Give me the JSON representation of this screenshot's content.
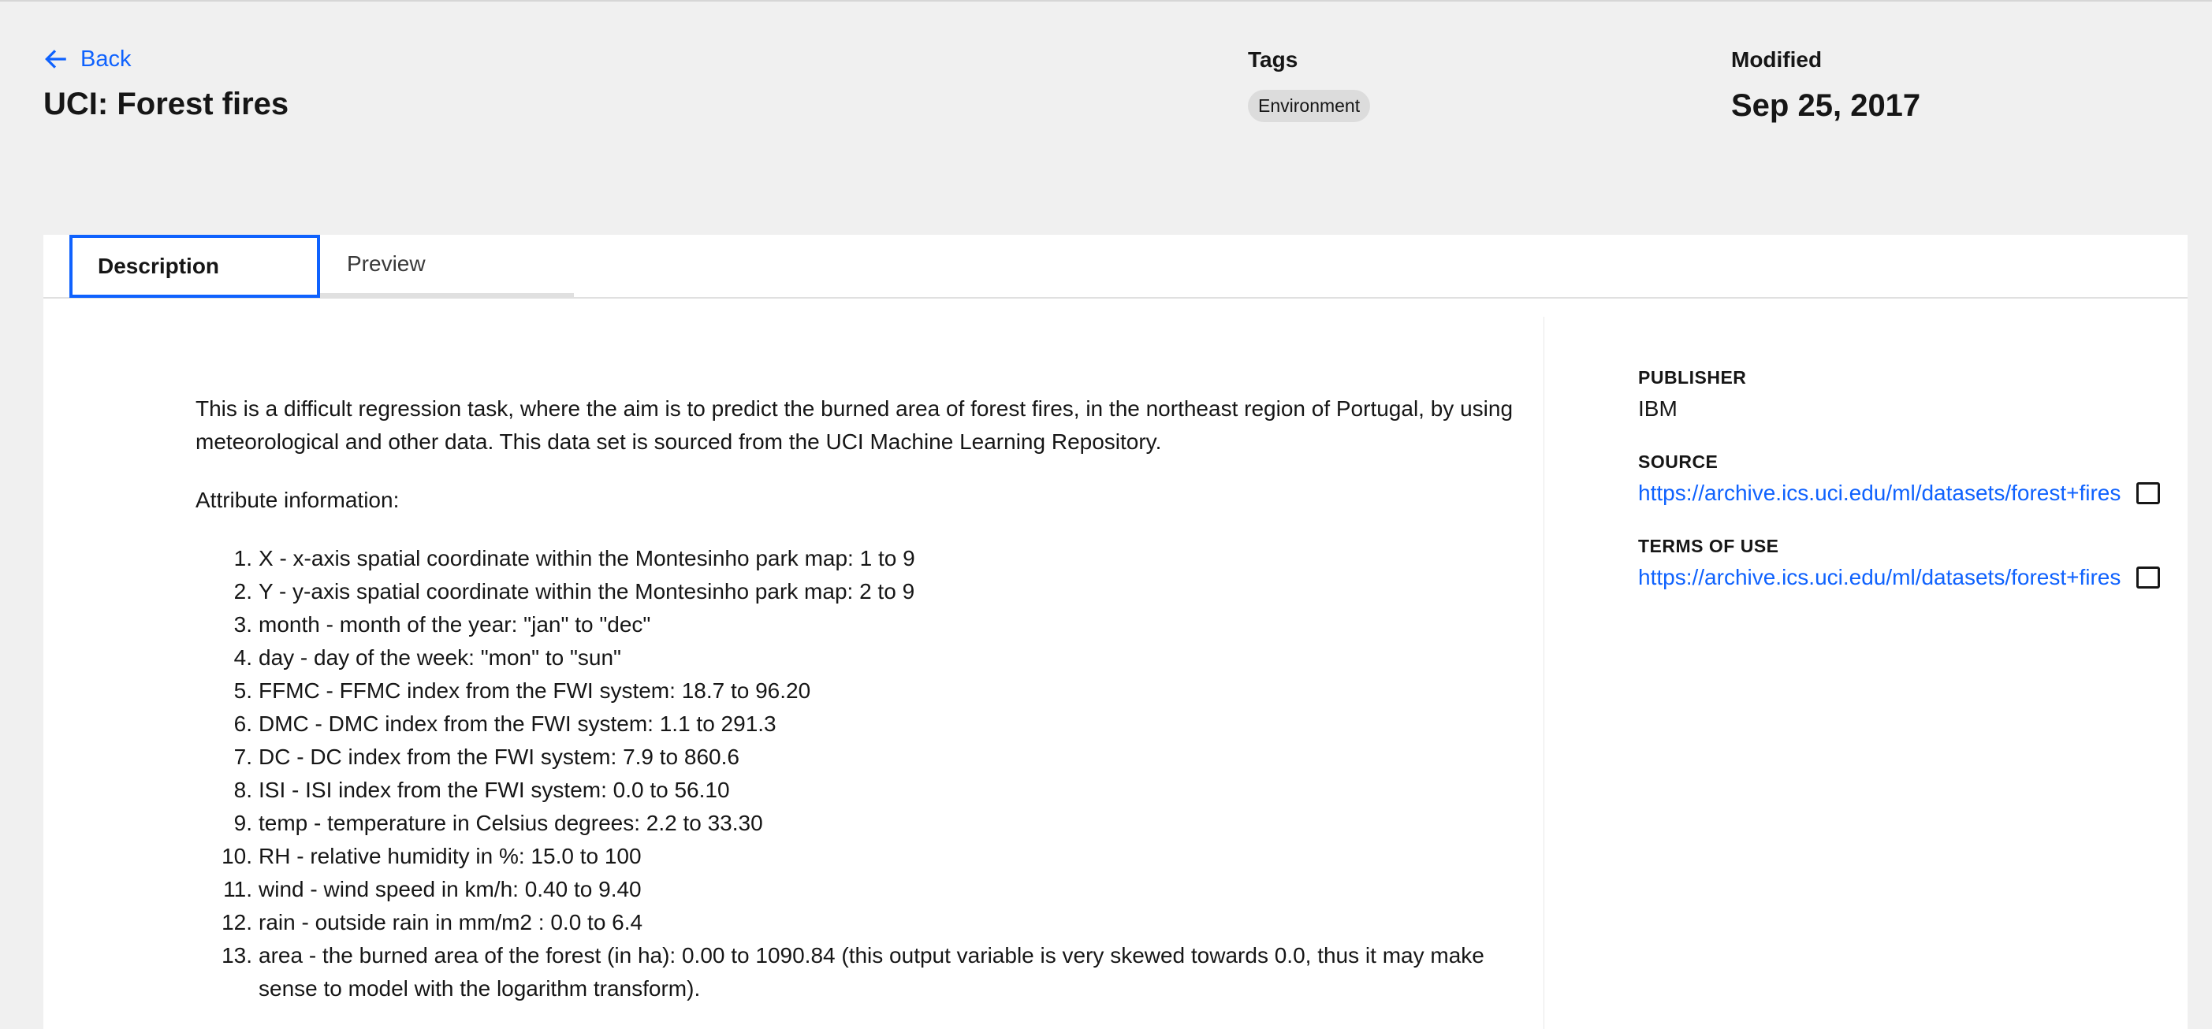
{
  "header": {
    "back_label": "Back",
    "title": "UCI: Forest fires",
    "tags_heading": "Tags",
    "tags": [
      "Environment"
    ],
    "modified_heading": "Modified",
    "modified_date": "Sep 25, 2017"
  },
  "tabs": [
    {
      "label": "Description",
      "selected": true
    },
    {
      "label": "Preview",
      "selected": false
    }
  ],
  "description": {
    "intro": "This is a difficult regression task, where the aim is to predict the burned area of forest fires, in the northeast region of Portugal, by using meteorological and other data. This data set is sourced from the UCI Machine Learning Repository.",
    "attributes_heading": "Attribute information:",
    "attributes": [
      "X - x-axis spatial coordinate within the Montesinho park map: 1 to 9",
      "Y - y-axis spatial coordinate within the Montesinho park map: 2 to 9",
      "month - month of the year: \"jan\" to \"dec\"",
      "day - day of the week: \"mon\" to \"sun\"",
      "FFMC - FFMC index from the FWI system: 18.7 to 96.20",
      "DMC - DMC index from the FWI system: 1.1 to 291.3",
      "DC - DC index from the FWI system: 7.9 to 860.6",
      "ISI - ISI index from the FWI system: 0.0 to 56.10",
      "temp - temperature in Celsius degrees: 2.2 to 33.30",
      "RH - relative humidity in %: 15.0 to 100",
      "wind - wind speed in km/h: 0.40 to 9.40",
      "rain - outside rain in mm/m2 : 0.0 to 6.4",
      "area - the burned area of the forest (in ha): 0.00 to 1090.84 (this output variable is very skewed towards 0.0, thus it may make sense to model with the logarithm transform)."
    ]
  },
  "sidebar": {
    "publisher_label": "PUBLISHER",
    "publisher": "IBM",
    "source_label": "SOURCE",
    "source_url": "https://archive.ics.uci.edu/ml/datasets/forest+fires",
    "terms_label": "TERMS OF USE",
    "terms_url": "https://archive.ics.uci.edu/ml/datasets/forest+fires"
  },
  "icons": {
    "back": "arrow-left-icon",
    "external": "launch-icon"
  },
  "colors": {
    "accent": "#0f62fe",
    "page_bg": "#f0f0f0",
    "card_bg": "#ffffff",
    "tag_bg": "#dcdcdc"
  }
}
